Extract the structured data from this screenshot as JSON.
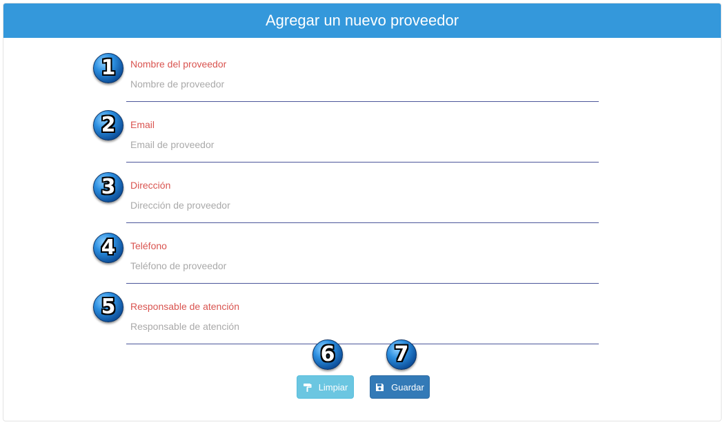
{
  "header": {
    "title": "Agregar un nuevo proveedor"
  },
  "form": {
    "fields": [
      {
        "step": "1",
        "label": "Nombre del proveedor",
        "placeholder": "Nombre de proveedor",
        "value": ""
      },
      {
        "step": "2",
        "label": "Email",
        "placeholder": "Email de proveedor",
        "value": ""
      },
      {
        "step": "3",
        "label": "Dirección",
        "placeholder": "Dirección de proveedor",
        "value": ""
      },
      {
        "step": "4",
        "label": "Teléfono",
        "placeholder": "Teléfono de proveedor",
        "value": ""
      },
      {
        "step": "5",
        "label": "Responsable de atención",
        "placeholder": "Responsable de atención",
        "value": ""
      }
    ]
  },
  "actions": {
    "clear": {
      "step": "6",
      "label": "Limpiar",
      "icon": "paint-roller-icon"
    },
    "save": {
      "step": "7",
      "label": "Guardar",
      "icon": "floppy-disk-icon"
    }
  },
  "colors": {
    "header_bg": "#3498db",
    "label": "#d9534f",
    "underline": "#4a5599",
    "btn_clear": "#5bc0de",
    "btn_save": "#337ab7"
  }
}
